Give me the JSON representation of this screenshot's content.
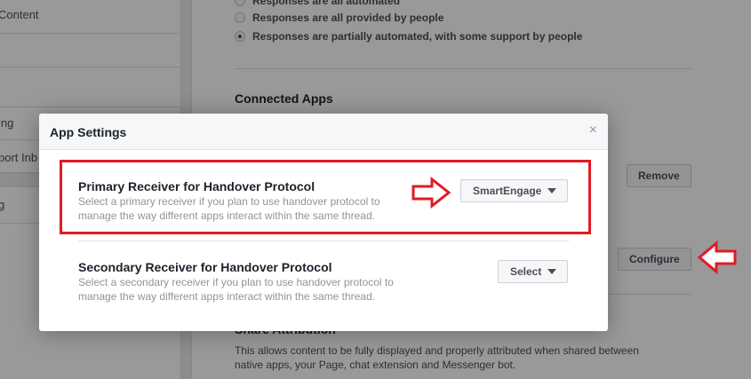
{
  "sidebar": {
    "items": [
      {
        "label": "Content"
      },
      {
        "label": ""
      },
      {
        "label": "ing"
      },
      {
        "label": "port Inb"
      },
      {
        "label": "g"
      }
    ]
  },
  "main": {
    "response_options": [
      {
        "label": "Responses are all automated",
        "selected": false
      },
      {
        "label": "Responses are all provided by people",
        "selected": false
      },
      {
        "label": "Responses are partially automated, with some support by people",
        "selected": true
      }
    ],
    "connected_apps_title": "Connected Apps",
    "remove_label": "Remove",
    "configure_label": "Configure",
    "share_attribution_title": "Share Attribution",
    "share_attribution_desc": "This allows content to be fully displayed and properly attributed when shared between native apps, your Page, chat extension and Messenger bot."
  },
  "dialog": {
    "title": "App Settings",
    "close_glyph": "×",
    "primary": {
      "title": "Primary Receiver for Handover Protocol",
      "description": "Select a primary receiver if you plan to use handover protocol to manage the way different apps interact within the same thread.",
      "select_value": "SmartEngage"
    },
    "secondary": {
      "title": "Secondary Receiver for Handover Protocol",
      "description": "Select a secondary receiver if you plan to use handover protocol to manage the way different apps interact within the same thread.",
      "select_value": "Select"
    }
  },
  "annotations": {
    "highlight_color": "#e01b24"
  }
}
